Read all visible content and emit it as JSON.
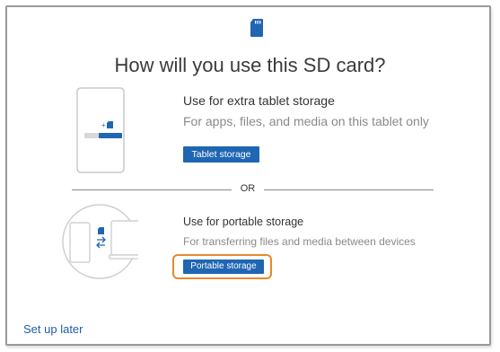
{
  "dialog": {
    "title": "How will you use this SD card?",
    "accent_color": "#1f66b3",
    "highlight_color": "#e48a2a",
    "header_icon": "sd-card-icon"
  },
  "options": [
    {
      "heading": "Use for extra tablet storage",
      "description": "For apps, files, and media on this tablet only",
      "button_label": "Tablet storage",
      "illustration": "tablet-storage-illustration"
    },
    {
      "heading": "Use for portable storage",
      "description": "For transferring files and media between devices",
      "button_label": "Portable storage",
      "illustration": "portable-storage-illustration"
    }
  ],
  "separator": {
    "label": "OR"
  },
  "footer": {
    "setup_later_label": "Set up later"
  }
}
